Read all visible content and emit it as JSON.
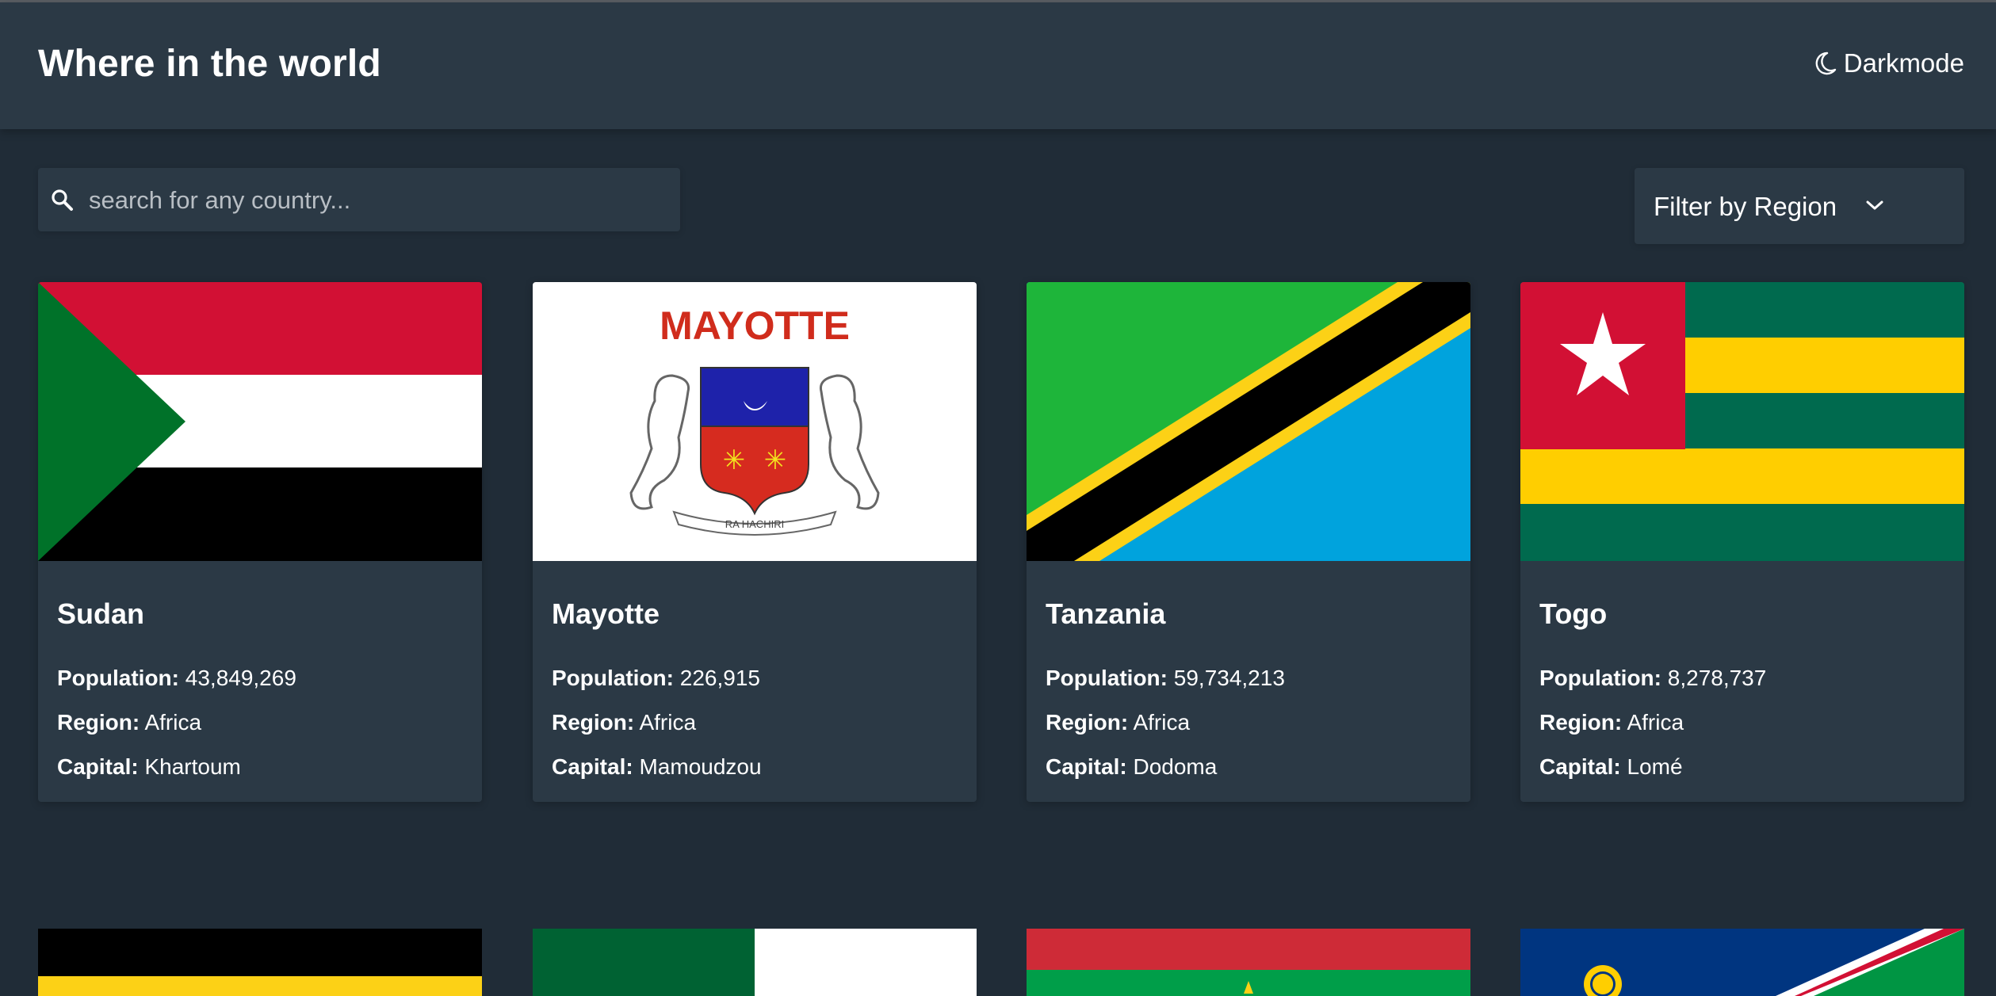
{
  "header": {
    "title": "Where in the world",
    "darkmode_label": "Darkmode"
  },
  "search": {
    "placeholder": "search for any country..."
  },
  "filter": {
    "label": "Filter by Region"
  },
  "field_labels": {
    "population": "Population:",
    "region": "Region:",
    "capital": "Capital:"
  },
  "countries": [
    {
      "name": "Sudan",
      "population": "43,849,269",
      "region": "Africa",
      "capital": "Khartoum"
    },
    {
      "name": "Mayotte",
      "population": "226,915",
      "region": "Africa",
      "capital": "Mamoudzou"
    },
    {
      "name": "Tanzania",
      "population": "59,734,213",
      "region": "Africa",
      "capital": "Dodoma"
    },
    {
      "name": "Togo",
      "population": "8,278,737",
      "region": "Africa",
      "capital": "Lomé"
    }
  ],
  "mayotte_flag": {
    "title_text": "MAYOTTE",
    "motto": "RA HACHIRI"
  },
  "colors": {
    "background": "#202c37",
    "element": "#2b3945",
    "text": "#ffffff"
  }
}
